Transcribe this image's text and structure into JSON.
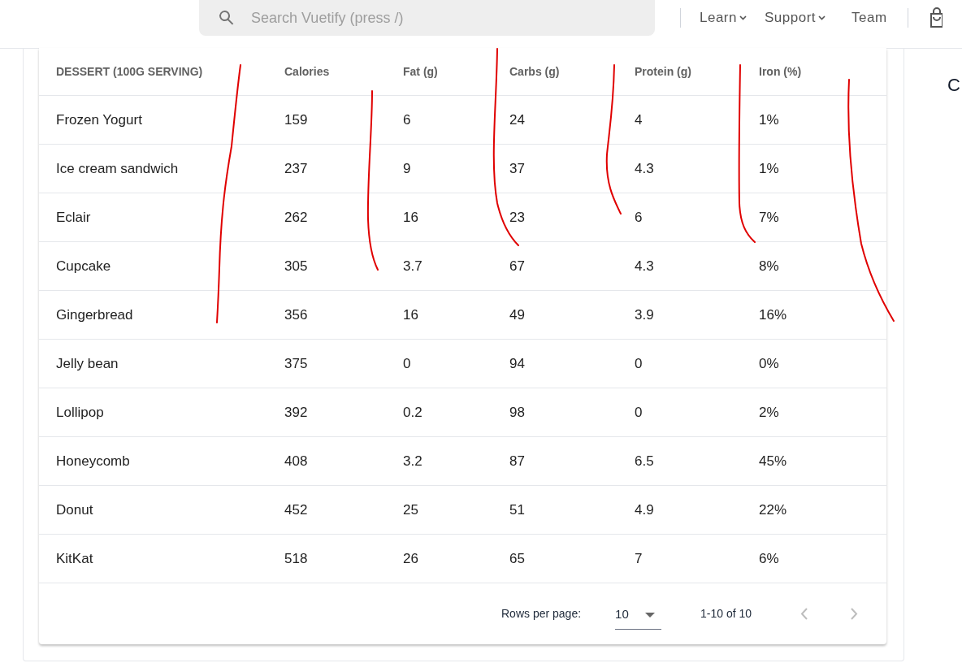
{
  "top_bar": {
    "search": {
      "placeholder": "Search Vuetify (press /)"
    },
    "nav": [
      {
        "label": "Learn",
        "kind": "menu"
      },
      {
        "label": "Support",
        "kind": "menu"
      },
      {
        "label": "Team",
        "kind": "link"
      }
    ]
  },
  "table": {
    "columns": [
      "DESSERT (100G SERVING)",
      "Calories",
      "Fat (g)",
      "Carbs (g)",
      "Protein (g)",
      "Iron (%)"
    ],
    "rows": [
      [
        "Frozen Yogurt",
        "159",
        "6",
        "24",
        "4",
        "1%"
      ],
      [
        "Ice cream sandwich",
        "237",
        "9",
        "37",
        "4.3",
        "1%"
      ],
      [
        "Eclair",
        "262",
        "16",
        "23",
        "6",
        "7%"
      ],
      [
        "Cupcake",
        "305",
        "3.7",
        "67",
        "4.3",
        "8%"
      ],
      [
        "Gingerbread",
        "356",
        "16",
        "49",
        "3.9",
        "16%"
      ],
      [
        "Jelly bean",
        "375",
        "0",
        "94",
        "0",
        "0%"
      ],
      [
        "Lollipop",
        "392",
        "0.2",
        "98",
        "0",
        "2%"
      ],
      [
        "Honeycomb",
        "408",
        "3.2",
        "87",
        "6.5",
        "45%"
      ],
      [
        "Donut",
        "452",
        "25",
        "51",
        "4.9",
        "22%"
      ],
      [
        "KitKat",
        "518",
        "26",
        "65",
        "7",
        "6%"
      ]
    ],
    "footer": {
      "rows_per_page_label": "Rows per page:",
      "rows_per_page": "10",
      "range": "1-10 of 10",
      "prev_disabled": true,
      "next_disabled": true
    }
  },
  "side_text": "C"
}
